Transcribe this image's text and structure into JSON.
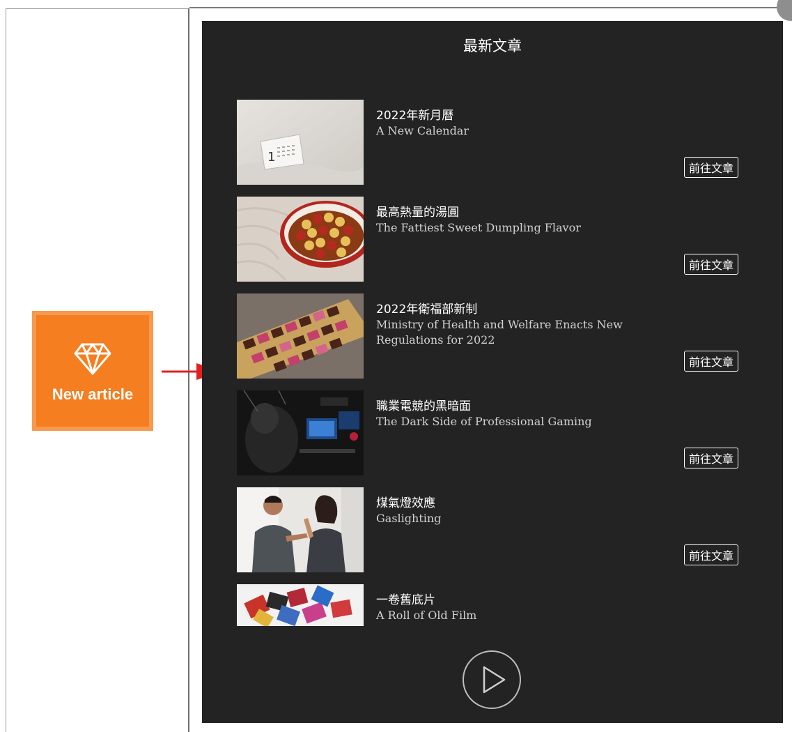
{
  "sidebar": {
    "new_article_label": "New article",
    "accent": "#f57e20",
    "arrow_color": "#e02020"
  },
  "panel": {
    "title": "最新文章",
    "background": "#232323",
    "articles": [
      {
        "title": "2022年新月曆",
        "subtitle": "A New Calendar",
        "button": "前往文章"
      },
      {
        "title": "最高熱量的湯圓",
        "subtitle": "The Fattiest Sweet Dumpling Flavor",
        "button": "前往文章"
      },
      {
        "title": "2022年衛福部新制",
        "subtitle": "Ministry of Health and Welfare Enacts New Regulations for 2022",
        "button": "前往文章"
      },
      {
        "title": "職業電競的黑暗面",
        "subtitle": "The Dark Side of Professional Gaming",
        "button": "前往文章"
      },
      {
        "title": "煤氣燈效應",
        "subtitle": "Gaslighting",
        "button": "前往文章"
      },
      {
        "title": "一卷舊底片",
        "subtitle": "A Roll of Old Film"
      }
    ],
    "play_icon": "play-circle-icon"
  }
}
